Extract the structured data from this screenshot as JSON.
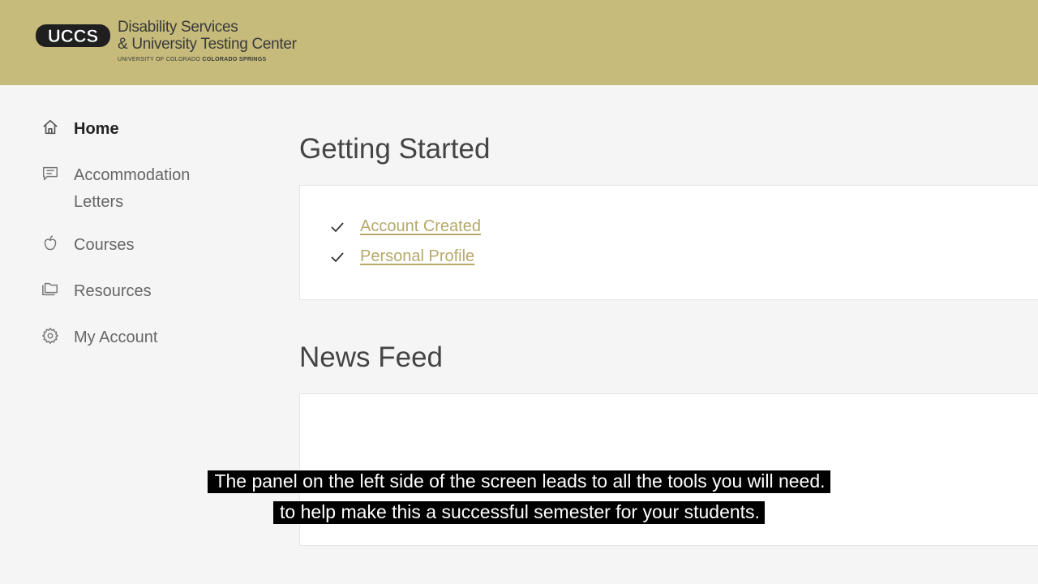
{
  "header": {
    "logo_mark": "UCCS",
    "title_line1": "Disability Services",
    "title_line2": "& University Testing Center",
    "subtitle_normal": "UNIVERSITY OF COLORADO",
    "subtitle_bold": "COLORADO SPRINGS"
  },
  "sidebar": {
    "items": [
      {
        "label": "Home",
        "icon": "home-icon"
      },
      {
        "label": "Accommodation Letters",
        "icon": "letter-icon"
      },
      {
        "label": "Courses",
        "icon": "apple-icon"
      },
      {
        "label": "Resources",
        "icon": "folder-icon"
      },
      {
        "label": "My Account",
        "icon": "gear-icon"
      }
    ]
  },
  "main": {
    "getting_started": {
      "title": "Getting Started",
      "items": [
        {
          "label": "Account Created",
          "icon": "check-icon"
        },
        {
          "label": "Personal Profile",
          "icon": "check-icon"
        }
      ]
    },
    "news_feed": {
      "title": "News Feed"
    }
  },
  "caption": {
    "line1": "The panel on the left side of the screen leads to all the tools you will need.",
    "line2": "to help make this a successful semester for your students."
  },
  "colors": {
    "header_bg": "#c6bb7b",
    "link": "#b6a96a",
    "page_bg": "#f5f5f5"
  }
}
